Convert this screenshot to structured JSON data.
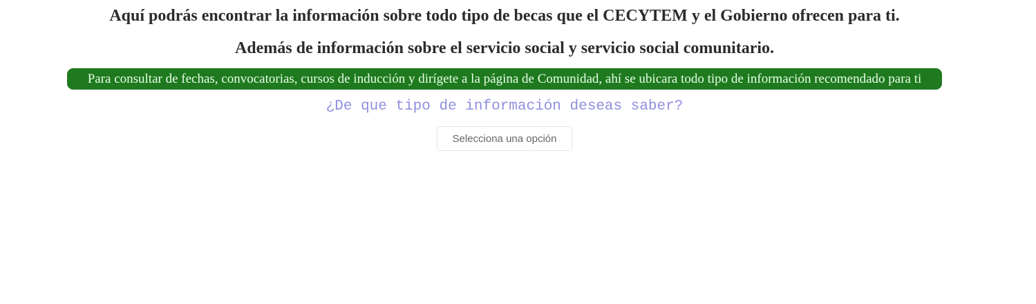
{
  "intro": {
    "line1": "Aquí podrás encontrar la información sobre todo tipo de becas que el CECYTEM y el Gobierno ofrecen para ti.",
    "line2": "Además de información sobre el servicio social y servicio social comunitario."
  },
  "banner": {
    "text": "Para consultar de fechas, convocatorias, cursos de inducción y dirígete a la página de Comunidad, ahí se ubicara todo tipo de información recomendado para ti"
  },
  "question": {
    "text": "¿De que tipo de información deseas saber?"
  },
  "select": {
    "selected": "Selecciona una opción",
    "options": [
      "Selecciona una opción"
    ]
  },
  "colors": {
    "banner_bg": "#1f7a1f",
    "question_text": "#8f8fe0"
  }
}
